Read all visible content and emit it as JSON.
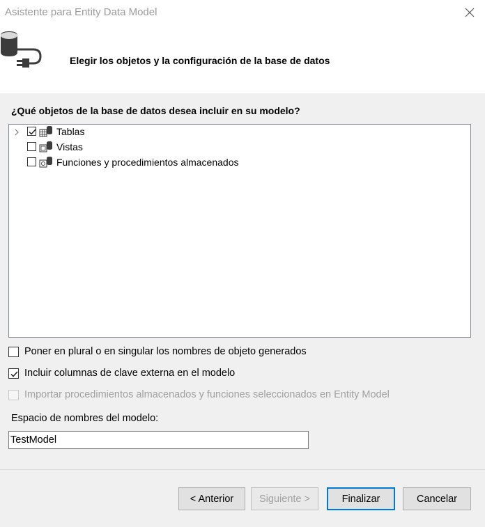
{
  "window": {
    "title": "Asistente para Entity Data Model",
    "close_icon": "close-icon"
  },
  "header": {
    "icon": "database-connect-icon",
    "title": "Elegir los objetos y la configuración de la base de datos"
  },
  "question": "¿Qué objetos de la base de datos desea incluir en su modelo?",
  "tree": {
    "items": [
      {
        "label": "Tablas",
        "checked": true,
        "expandable": true,
        "icon": "tables-icon"
      },
      {
        "label": "Vistas",
        "checked": false,
        "expandable": false,
        "icon": "views-icon"
      },
      {
        "label": "Funciones y procedimientos almacenados",
        "checked": false,
        "expandable": false,
        "icon": "stored-procedures-icon"
      }
    ]
  },
  "options": [
    {
      "label": "Poner en plural o en singular los nombres de objeto generados",
      "checked": false,
      "enabled": true
    },
    {
      "label": "Incluir columnas de clave externa en el modelo",
      "checked": true,
      "enabled": true
    },
    {
      "label": "Importar procedimientos almacenados y funciones seleccionados en Entity Model",
      "checked": false,
      "enabled": false
    }
  ],
  "namespace": {
    "label": "Espacio de nombres del modelo:",
    "value": "TestModel"
  },
  "buttons": {
    "previous": "< Anterior",
    "next": "Siguiente >",
    "finish": "Finalizar",
    "cancel": "Cancelar"
  },
  "colors": {
    "accent": "#0078d7",
    "disabled_text": "#a0a0a0"
  }
}
